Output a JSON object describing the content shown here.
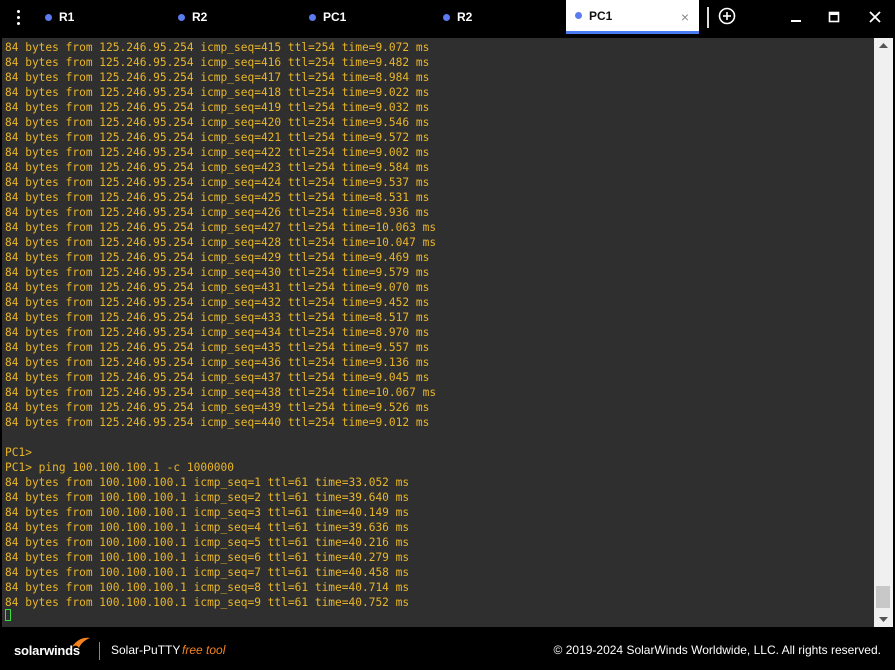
{
  "tabs": [
    {
      "label": "R1",
      "active": false
    },
    {
      "label": "R2",
      "active": false
    },
    {
      "label": "PC1",
      "active": false
    },
    {
      "label": "R2",
      "active": false
    },
    {
      "label": "PC1",
      "active": true
    }
  ],
  "tab_close_glyph": "×",
  "window": {
    "minimize": "—",
    "maximize": "□",
    "close": "✕"
  },
  "colors": {
    "terminal_bg": "#2f2f2f",
    "terminal_text": "#e8b52a",
    "accent": "#4a7bf0",
    "cursor": "#3ddc3d",
    "free_tool": "#f5821f"
  },
  "terminal": {
    "lines": [
      "84 bytes from 125.246.95.254 icmp_seq=415 ttl=254 time=9.072 ms",
      "84 bytes from 125.246.95.254 icmp_seq=416 ttl=254 time=9.482 ms",
      "84 bytes from 125.246.95.254 icmp_seq=417 ttl=254 time=8.984 ms",
      "84 bytes from 125.246.95.254 icmp_seq=418 ttl=254 time=9.022 ms",
      "84 bytes from 125.246.95.254 icmp_seq=419 ttl=254 time=9.032 ms",
      "84 bytes from 125.246.95.254 icmp_seq=420 ttl=254 time=9.546 ms",
      "84 bytes from 125.246.95.254 icmp_seq=421 ttl=254 time=9.572 ms",
      "84 bytes from 125.246.95.254 icmp_seq=422 ttl=254 time=9.002 ms",
      "84 bytes from 125.246.95.254 icmp_seq=423 ttl=254 time=9.584 ms",
      "84 bytes from 125.246.95.254 icmp_seq=424 ttl=254 time=9.537 ms",
      "84 bytes from 125.246.95.254 icmp_seq=425 ttl=254 time=8.531 ms",
      "84 bytes from 125.246.95.254 icmp_seq=426 ttl=254 time=8.936 ms",
      "84 bytes from 125.246.95.254 icmp_seq=427 ttl=254 time=10.063 ms",
      "84 bytes from 125.246.95.254 icmp_seq=428 ttl=254 time=10.047 ms",
      "84 bytes from 125.246.95.254 icmp_seq=429 ttl=254 time=9.469 ms",
      "84 bytes from 125.246.95.254 icmp_seq=430 ttl=254 time=9.579 ms",
      "84 bytes from 125.246.95.254 icmp_seq=431 ttl=254 time=9.070 ms",
      "84 bytes from 125.246.95.254 icmp_seq=432 ttl=254 time=9.452 ms",
      "84 bytes from 125.246.95.254 icmp_seq=433 ttl=254 time=8.517 ms",
      "84 bytes from 125.246.95.254 icmp_seq=434 ttl=254 time=8.970 ms",
      "84 bytes from 125.246.95.254 icmp_seq=435 ttl=254 time=9.557 ms",
      "84 bytes from 125.246.95.254 icmp_seq=436 ttl=254 time=9.136 ms",
      "84 bytes from 125.246.95.254 icmp_seq=437 ttl=254 time=9.045 ms",
      "84 bytes from 125.246.95.254 icmp_seq=438 ttl=254 time=10.067 ms",
      "84 bytes from 125.246.95.254 icmp_seq=439 ttl=254 time=9.526 ms",
      "84 bytes from 125.246.95.254 icmp_seq=440 ttl=254 time=9.012 ms",
      "",
      "PC1>",
      "PC1> ping 100.100.100.1 -c 1000000",
      "84 bytes from 100.100.100.1 icmp_seq=1 ttl=61 time=33.052 ms",
      "84 bytes from 100.100.100.1 icmp_seq=2 ttl=61 time=39.640 ms",
      "84 bytes from 100.100.100.1 icmp_seq=3 ttl=61 time=40.149 ms",
      "84 bytes from 100.100.100.1 icmp_seq=4 ttl=61 time=39.636 ms",
      "84 bytes from 100.100.100.1 icmp_seq=5 ttl=61 time=40.216 ms",
      "84 bytes from 100.100.100.1 icmp_seq=6 ttl=61 time=40.279 ms",
      "84 bytes from 100.100.100.1 icmp_seq=7 ttl=61 time=40.458 ms",
      "84 bytes from 100.100.100.1 icmp_seq=8 ttl=61 time=40.714 ms",
      "84 bytes from 100.100.100.1 icmp_seq=9 ttl=61 time=40.752 ms"
    ]
  },
  "status": {
    "brand": "solarwinds",
    "product": "Solar-PuTTY",
    "free_tool": "free tool",
    "copyright": "© 2019-2024 SolarWinds Worldwide, LLC. All rights reserved."
  }
}
